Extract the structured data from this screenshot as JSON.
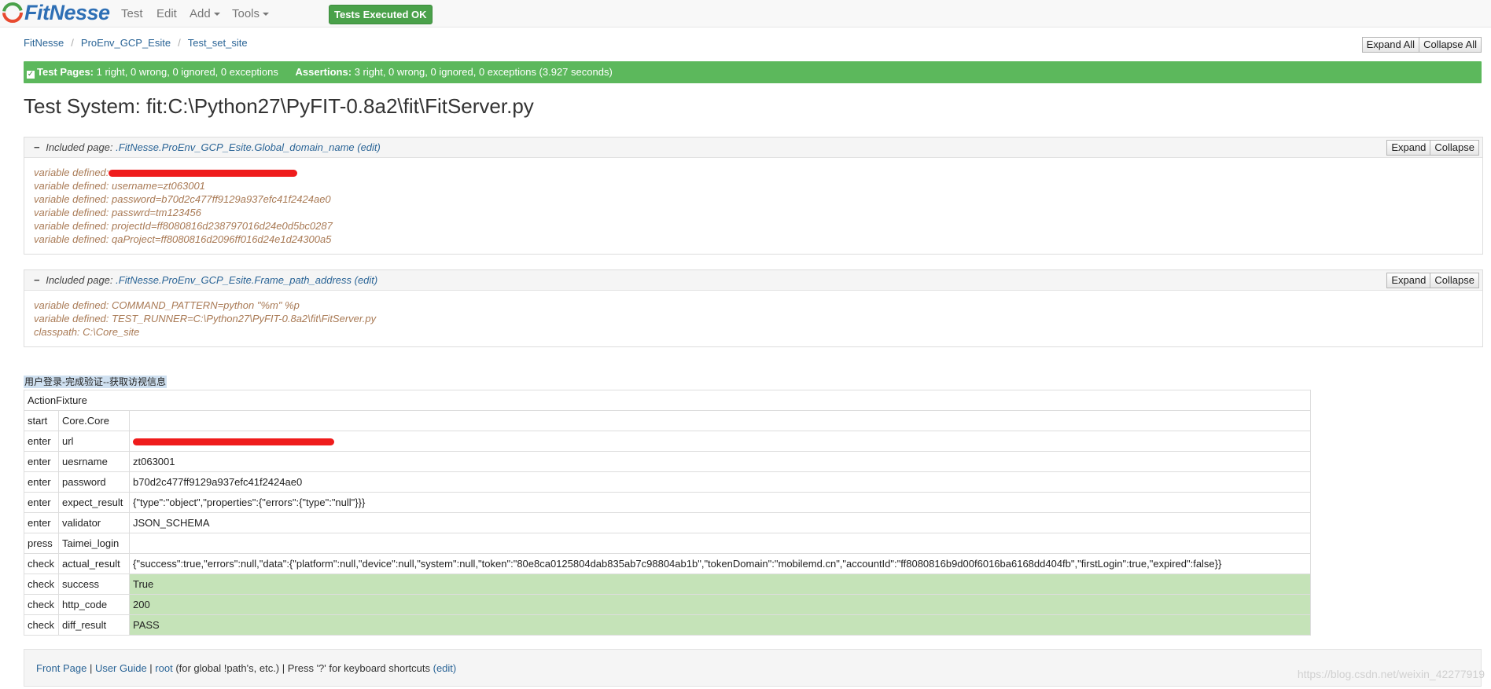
{
  "app": {
    "logo_text": "FitNesse",
    "nav": [
      "Test",
      "Edit",
      "Add",
      "Tools"
    ],
    "badge": "Tests Executed OK"
  },
  "breadcrumb": [
    "FitNesse",
    "ProEnv_GCP_Esite",
    "Test_set_site"
  ],
  "page_buttons": {
    "expand_all": "Expand All",
    "collapse_all": "Collapse All"
  },
  "status": {
    "pages_label": "Test Pages:",
    "pages_text": "1 right, 0 wrong, 0 ignored, 0 exceptions",
    "assertions_label": "Assertions:",
    "assertions_text": "3 right, 0 wrong, 0 ignored, 0 exceptions (3.927 seconds)"
  },
  "title": "Test System: fit:C:\\Python27\\PyFIT-0.8a2\\fit\\FitServer.py",
  "included": [
    {
      "prefix": "Included page:",
      "link": ".FitNesse.ProEnv_GCP_Esite.Global_domain_name",
      "edit": "(edit)",
      "expand": "Expand",
      "collapse": "Collapse",
      "lines": [
        "variable defined: ",
        "variable defined: username=zt063001",
        "variable defined: password=b70d2c477ff9129a937efc41f2424ae0",
        "variable defined: passwrd=tm123456",
        "variable defined: projectId=ff8080816d238797016d24e0d5bc0287",
        "variable defined: qaProject=ff8080816d2096ff016d24e1d24300a5"
      ]
    },
    {
      "prefix": "Included page:",
      "link": ".FitNesse.ProEnv_GCP_Esite.Frame_path_address",
      "edit": "(edit)",
      "expand": "Expand",
      "collapse": "Collapse",
      "lines": [
        "variable defined: COMMAND_PATTERN=python \"%m\" %p",
        "variable defined: TEST_RUNNER=C:\\Python27\\PyFIT-0.8a2\\fit\\FitServer.py",
        "classpath: C:\\Core_site"
      ]
    }
  ],
  "table_caption": "用户登录-完成验证--获取访视信息",
  "table": {
    "fixture": "ActionFixture",
    "rows": [
      [
        "start",
        "Core.Core",
        ""
      ],
      [
        "enter",
        "url",
        ""
      ],
      [
        "enter",
        "uesrname",
        "zt063001"
      ],
      [
        "enter",
        "password",
        "b70d2c477ff9129a937efc41f2424ae0"
      ],
      [
        "enter",
        "expect_result",
        "{\"type\":\"object\",\"properties\":{\"errors\":{\"type\":\"null\"}}}"
      ],
      [
        "enter",
        "validator",
        "JSON_SCHEMA"
      ],
      [
        "press",
        "Taimei_login",
        ""
      ],
      [
        "check",
        "actual_result",
        "{\"success\":true,\"errors\":null,\"data\":{\"platform\":null,\"device\":null,\"system\":null,\"token\":\"80e8ca0125804dab835ab7c98804ab1b\",\"tokenDomain\":\"mobilemd.cn\",\"accountId\":\"ff8080816b9d00f6016ba6168dd404fb\",\"firstLogin\":true,\"expired\":false}}"
      ],
      [
        "check",
        "success",
        "True"
      ],
      [
        "check",
        "http_code",
        "200"
      ],
      [
        "check",
        "diff_result",
        "PASS"
      ]
    ],
    "pass_rows": [
      8,
      9,
      10
    ]
  },
  "footer": {
    "front_page": "Front Page",
    "sep1": " | ",
    "user_guide": "User Guide",
    "sep2": " | ",
    "root": "root",
    "rest": " (for global !path's, etc.) | Press '?' for keyboard shortcuts ",
    "edit": "(edit)"
  },
  "watermark": "https://blog.csdn.net/weixin_42277919",
  "colors": {
    "brand": "#2e6fb5",
    "ok": "#5cb85c",
    "pass_cell": "#c5e3b8",
    "included_text": "#a97a55"
  }
}
